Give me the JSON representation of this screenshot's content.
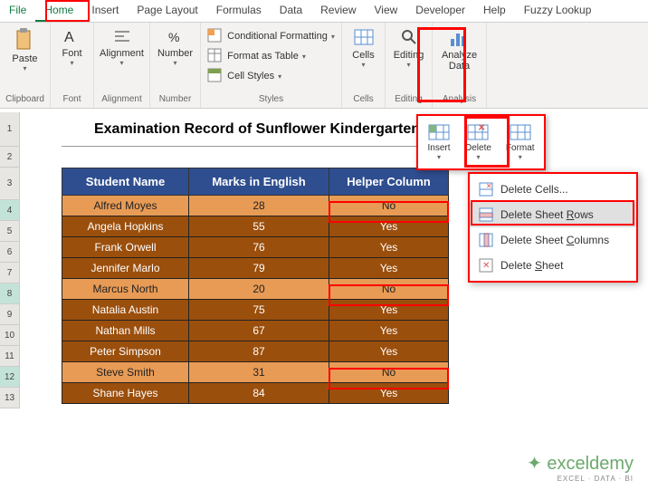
{
  "ribbon": {
    "tabs": [
      "File",
      "Home",
      "Insert",
      "Page Layout",
      "Formulas",
      "Data",
      "Review",
      "View",
      "Developer",
      "Help",
      "Fuzzy Lookup"
    ],
    "groups": {
      "clipboard": {
        "label": "Clipboard",
        "paste": "Paste"
      },
      "font": {
        "label": "Font",
        "btn": "Font"
      },
      "alignment": {
        "label": "Alignment",
        "btn": "Alignment"
      },
      "number": {
        "label": "Number",
        "btn": "Number"
      },
      "styles": {
        "label": "Styles",
        "cf": "Conditional Formatting",
        "fat": "Format as Table",
        "cs": "Cell Styles"
      },
      "cells": {
        "label": "Cells",
        "btn": "Cells"
      },
      "editing": {
        "label": "Editing",
        "btn": "Editing"
      },
      "analysis": {
        "label": "Analysis",
        "btn": "Analyze Data"
      }
    }
  },
  "cells_dropdown": {
    "insert": "Insert",
    "delete": "Delete",
    "format": "Format"
  },
  "delete_menu": {
    "cells": "Delete Cells...",
    "rows_pre": "Delete Sheet ",
    "rows_u": "R",
    "rows_post": "ows",
    "cols_pre": "Delete Sheet ",
    "cols_u": "C",
    "cols_post": "olumns",
    "sheet_pre": "Delete ",
    "sheet_u": "S",
    "sheet_post": "heet"
  },
  "title": "Examination Record of Sunflower Kindergarten",
  "headers": {
    "a": "Student Name",
    "b": "Marks in English",
    "c": "Helper Column"
  },
  "rows": [
    {
      "name": "Alfred Moyes",
      "marks": "28",
      "helper": "No",
      "sel": true
    },
    {
      "name": "Angela Hopkins",
      "marks": "55",
      "helper": "Yes",
      "sel": false
    },
    {
      "name": "Frank Orwell",
      "marks": "76",
      "helper": "Yes",
      "sel": false
    },
    {
      "name": "Jennifer Marlo",
      "marks": "79",
      "helper": "Yes",
      "sel": false
    },
    {
      "name": "Marcus North",
      "marks": "20",
      "helper": "No",
      "sel": true
    },
    {
      "name": "Natalia Austin",
      "marks": "75",
      "helper": "Yes",
      "sel": false
    },
    {
      "name": "Nathan Mills",
      "marks": "67",
      "helper": "Yes",
      "sel": false
    },
    {
      "name": "Peter Simpson",
      "marks": "87",
      "helper": "Yes",
      "sel": false
    },
    {
      "name": "Steve Smith",
      "marks": "31",
      "helper": "No",
      "sel": true
    },
    {
      "name": "Shane Hayes",
      "marks": "84",
      "helper": "Yes",
      "sel": false
    }
  ],
  "watermark": {
    "main": "exceldemy",
    "sub": "EXCEL · DATA · BI"
  },
  "chart_data": {
    "type": "table",
    "title": "Examination Record of Sunflower Kindergarten",
    "columns": [
      "Student Name",
      "Marks in English",
      "Helper Column"
    ],
    "records": [
      [
        "Alfred Moyes",
        28,
        "No"
      ],
      [
        "Angela Hopkins",
        55,
        "Yes"
      ],
      [
        "Frank Orwell",
        76,
        "Yes"
      ],
      [
        "Jennifer Marlo",
        79,
        "Yes"
      ],
      [
        "Marcus North",
        20,
        "No"
      ],
      [
        "Natalia Austin",
        75,
        "Yes"
      ],
      [
        "Nathan Mills",
        67,
        "Yes"
      ],
      [
        "Peter Simpson",
        87,
        "Yes"
      ],
      [
        "Steve Smith",
        31,
        "No"
      ],
      [
        "Shane Hayes",
        84,
        "Yes"
      ]
    ]
  }
}
